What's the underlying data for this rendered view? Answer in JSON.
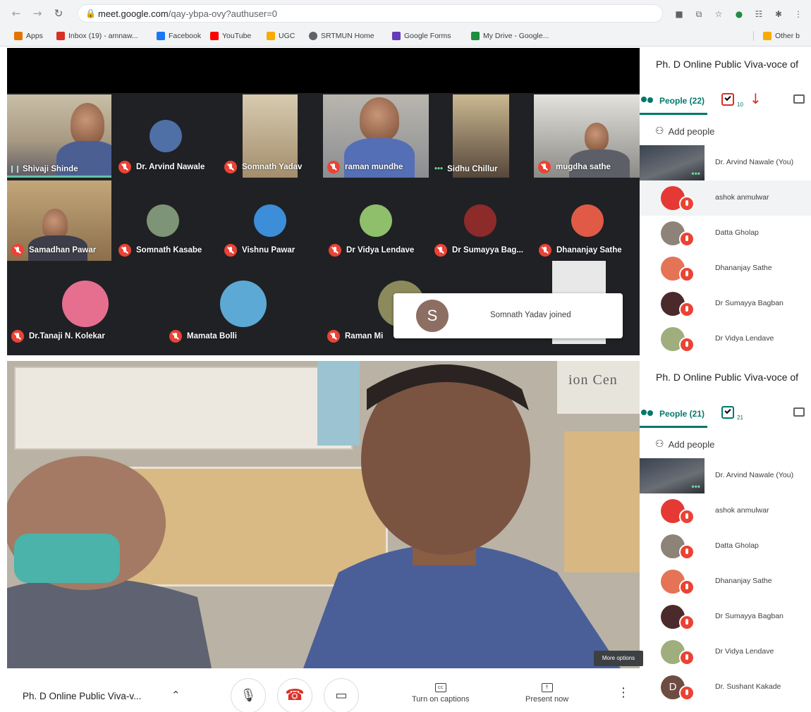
{
  "browser": {
    "url_host": "meet.google.com",
    "url_path": "/qay-ybpa-ovy?authuser=0",
    "bookmarks": [
      {
        "label": "Apps",
        "color": "#e37400"
      },
      {
        "label": "Inbox (19) - amnaw...",
        "color": "#d93025"
      },
      {
        "label": "Facebook",
        "color": "#1877f2"
      },
      {
        "label": "YouTube",
        "color": "#ff0000"
      },
      {
        "label": "UGC",
        "color": "#f9ab00"
      },
      {
        "label": "SRTMUN Home",
        "color": "#5f6368"
      },
      {
        "label": "Google Forms",
        "color": "#673ab7"
      },
      {
        "label": "My Drive - Google...",
        "color": "#1e8e3e"
      }
    ],
    "other_bookmarks": "Other b"
  },
  "grid": {
    "participants": [
      {
        "name": "Shivaji Shinde",
        "speaking": true
      },
      {
        "name": "Dr. Arvind Nawale"
      },
      {
        "name": "Somnath Yadav"
      },
      {
        "name": "raman mundhe"
      },
      {
        "name": "Sidhu Chillur"
      },
      {
        "name": "mugdha sathe"
      },
      {
        "name": "Samadhan Pawar"
      },
      {
        "name": "Somnath Kasabe"
      },
      {
        "name": "Vishnu Pawar"
      },
      {
        "name": "Dr Vidya Lendave"
      },
      {
        "name": "Dr Sumayya Bag..."
      },
      {
        "name": "Dhananjay Sathe"
      },
      {
        "name": "Dr.Tanaji N. Kolekar"
      },
      {
        "name": "Mamata Bolli"
      },
      {
        "name": "Raman Mi"
      }
    ],
    "toast": {
      "initial": "S",
      "text": "Somnath Yadav joined"
    }
  },
  "panel_top": {
    "title": "Ph. D Online Public Viva-voce of",
    "people_tab": "People (22)",
    "task_count": "10",
    "add_people": "Add people",
    "people": [
      {
        "name": "Dr. Arvind Nawale (You)",
        "video": true
      },
      {
        "name": "ashok anmulwar",
        "color": "#e53935",
        "highlight": true
      },
      {
        "name": "Datta Gholap",
        "color": "#8d8378"
      },
      {
        "name": "Dhananjay Sathe",
        "color": "#e57355"
      },
      {
        "name": "Dr Sumayya Bagban",
        "color": "#4a2a2a"
      },
      {
        "name": "Dr Vidya Lendave",
        "color": "#9fae7c"
      }
    ]
  },
  "panel_bottom": {
    "title": "Ph. D Online Public Viva-voce of",
    "people_tab": "People (21)",
    "task_count": "21",
    "add_people": "Add people",
    "people": [
      {
        "name": "Dr. Arvind Nawale (You)",
        "video": true
      },
      {
        "name": "ashok anmulwar",
        "color": "#e53935"
      },
      {
        "name": "Datta Gholap",
        "color": "#8d8378"
      },
      {
        "name": "Dhananjay Sathe",
        "color": "#e57355"
      },
      {
        "name": "Dr Sumayya Bagban",
        "color": "#4a2a2a"
      },
      {
        "name": "Dr Vidya Lendave",
        "color": "#9fae7c"
      },
      {
        "name": "Dr. Sushant Kakade",
        "color": "#6d4c41",
        "initial": "D"
      }
    ]
  },
  "main": {
    "sign_text": "ion Cen",
    "more_options": "More options"
  },
  "bottombar": {
    "meeting_title": "Ph. D Online Public Viva-v...",
    "captions_label": "Turn on captions",
    "present_label": "Present now"
  }
}
